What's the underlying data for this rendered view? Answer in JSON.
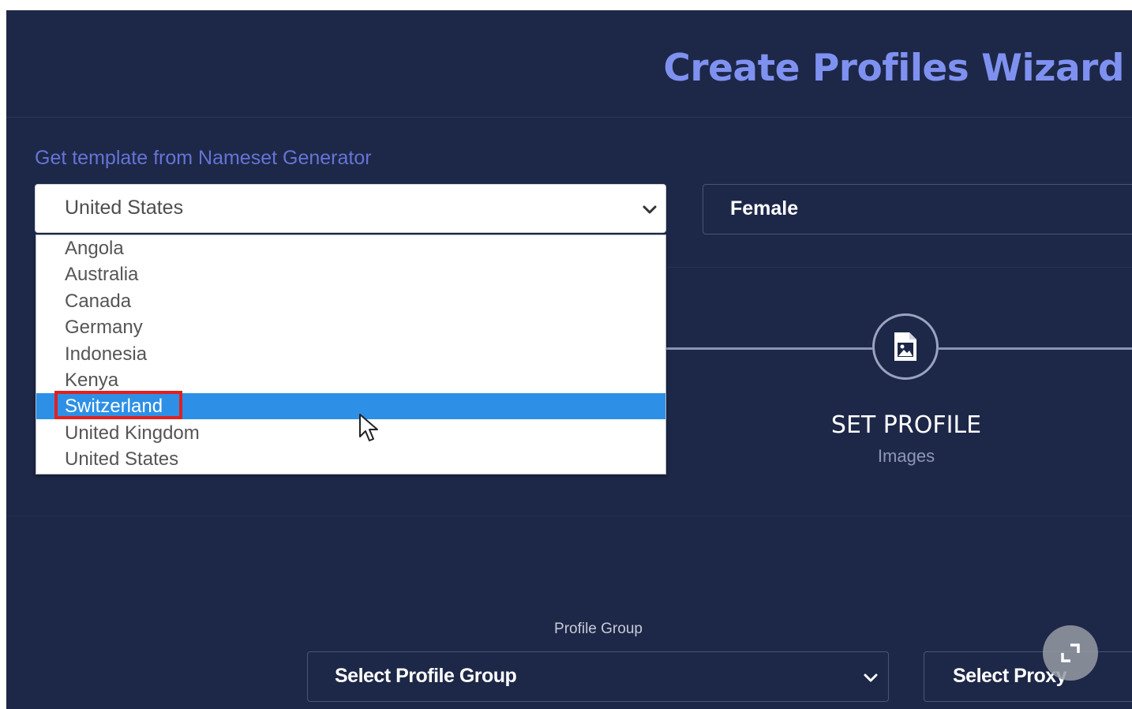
{
  "header": {
    "title": "Create Profiles Wizard"
  },
  "template": {
    "label": "Get template from Nameset Generator",
    "country_selected": "United States",
    "country_options": [
      "Angola",
      "Australia",
      "Canada",
      "Germany",
      "Indonesia",
      "Kenya",
      "Switzerland",
      "United Kingdom",
      "United States"
    ],
    "highlighted_option": "Switzerland",
    "gender_selected": "Female"
  },
  "step": {
    "icon": "image-file-icon",
    "title": "SET PROFILE",
    "subtitle": "Images"
  },
  "profile_group": {
    "label": "Profile Group",
    "placeholder": "Select Profile Group"
  },
  "proxy": {
    "placeholder": "Select Proxy"
  },
  "overlay": {
    "fullscreen_icon": "fullscreen-icon"
  },
  "colors": {
    "background": "#1d2747",
    "title": "#7f91f0",
    "label": "#6574d6",
    "selection": "#2d90e6",
    "highlight_box": "#e02020"
  }
}
